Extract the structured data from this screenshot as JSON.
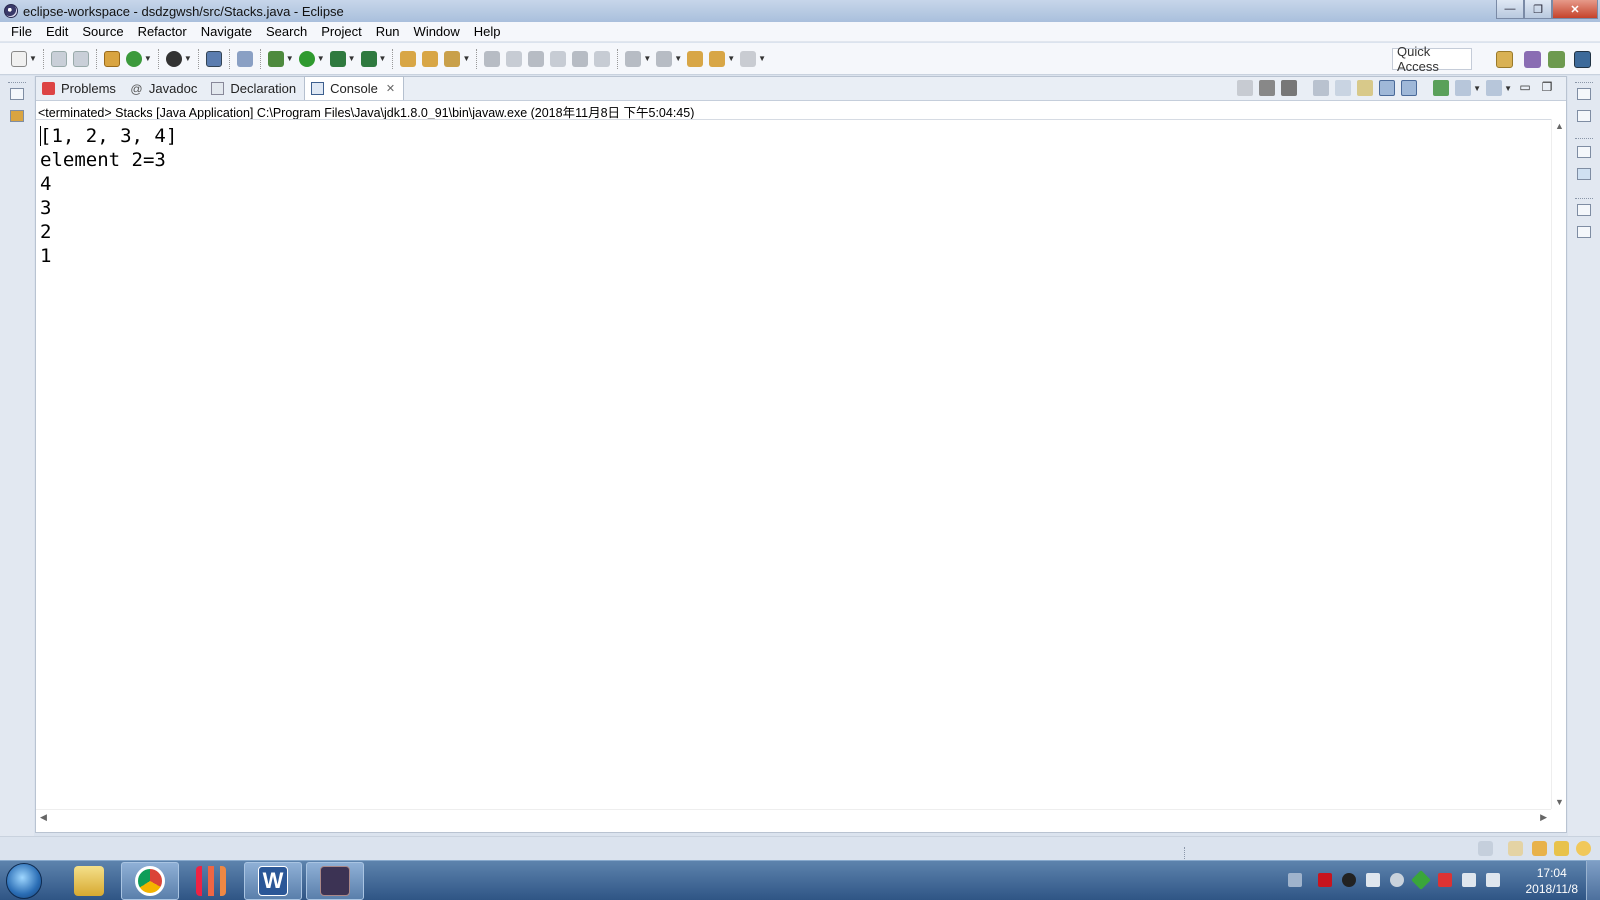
{
  "window": {
    "title": "eclipse-workspace - dsdzgwsh/src/Stacks.java - Eclipse",
    "minimize": "—",
    "restore": "❐",
    "close": "✕"
  },
  "menu": [
    "File",
    "Edit",
    "Source",
    "Refactor",
    "Navigate",
    "Search",
    "Project",
    "Run",
    "Window",
    "Help"
  ],
  "quick_access": "Quick Access",
  "tabs": [
    {
      "label": "Problems",
      "icon": "problems-icon"
    },
    {
      "label": "Javadoc",
      "icon": "javadoc-icon"
    },
    {
      "label": "Declaration",
      "icon": "declaration-icon"
    },
    {
      "label": "Console",
      "icon": "console-icon",
      "active": true
    }
  ],
  "tab_close": "✕",
  "console": {
    "status": "<terminated> Stacks [Java Application] C:\\Program Files\\Java\\jdk1.8.0_91\\bin\\javaw.exe (2018年11月8日 下午5:04:45)",
    "lines": [
      "[1, 2, 3, 4]",
      "element 2=3",
      "4",
      "3",
      "2",
      "1"
    ]
  },
  "clock": {
    "time": "17:04",
    "date": "2018/11/8"
  },
  "colors": {
    "accent": "#2f5585",
    "title_bar": "#b7cae4",
    "console_bg": "#ffffff"
  }
}
